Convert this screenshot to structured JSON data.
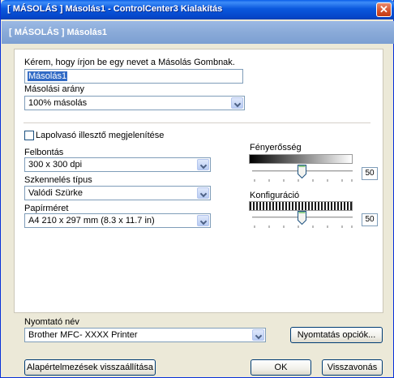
{
  "window": {
    "title": "[ MÁSOLÁS ]  Másolás1 - ControlCenter3 Kialakítás"
  },
  "header": {
    "text": "[ MÁSOLÁS ]  Másolás1"
  },
  "name_prompt": "Kérem, hogy írjon be egy nevet a Másolás Gombnak.",
  "name_value": "Másolás1",
  "copy_ratio": {
    "label": "Másolási arány",
    "value": "100% másolás"
  },
  "show_scanner_interface": {
    "label": "Lapolvasó illesztő megjelenítése",
    "checked": false
  },
  "resolution": {
    "label": "Felbontás",
    "value": "300 x 300 dpi"
  },
  "scan_type": {
    "label": "Szkennelés típus",
    "value": "Valódi Szürke"
  },
  "paper_size": {
    "label": "Papírméret",
    "value": "A4 210 x 297 mm (8.3 x 11.7 in)"
  },
  "brightness": {
    "label": "Fényerősség",
    "value": "50"
  },
  "contrast": {
    "label": "Konfiguráció",
    "value": "50"
  },
  "printer": {
    "label": "Nyomtató név",
    "value": "Brother MFC- XXXX  Printer"
  },
  "buttons": {
    "print_options": "Nyomtatás opciók...",
    "restore_defaults": "Alapértelmezések visszaállítása",
    "ok": "OK",
    "cancel": "Visszavonás"
  },
  "colors": {
    "title_blue": "#0a58dd",
    "header_blue": "#8aaad8",
    "selection": "#316ac5"
  }
}
